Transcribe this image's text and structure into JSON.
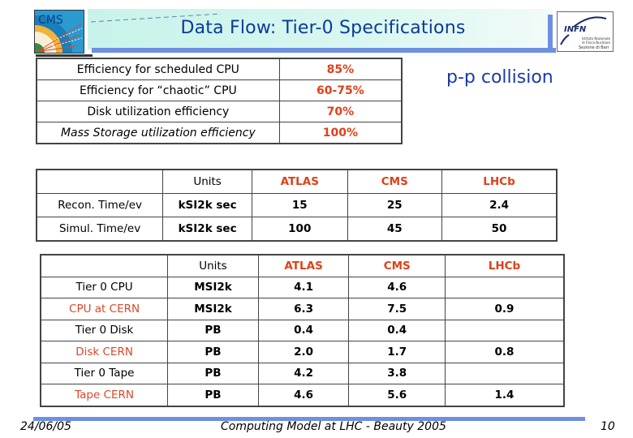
{
  "header": {
    "title": "Data Flow: Tier-0 Specifications",
    "left_logo": "CMS",
    "right_logo": "INFN",
    "right_logo_subtitle": "Istituto Nazionale di Fisica Nucleare Sezione di Bari"
  },
  "annotation": "p-p collision",
  "efficiency_table": {
    "rows": [
      {
        "label": "Efficiency for scheduled CPU",
        "value": "85%"
      },
      {
        "label": "Efficiency for “chaotic” CPU",
        "value": "60-75%"
      },
      {
        "label": "Disk utilization efficiency",
        "value": "70%"
      },
      {
        "label": "Mass Storage utilization efficiency",
        "value": "100%"
      }
    ]
  },
  "time_table": {
    "headers": [
      "",
      "Units",
      "ATLAS",
      "CMS",
      "LHCb"
    ],
    "rows": [
      [
        "Recon. Time/ev",
        "kSI2k sec",
        "15",
        "25",
        "2.4"
      ],
      [
        "Simul. Time/ev",
        "kSI2k sec",
        "100",
        "45",
        "50"
      ]
    ]
  },
  "resource_table": {
    "headers": [
      "",
      "Units",
      "ATLAS",
      "CMS",
      "LHCb"
    ],
    "rows": [
      [
        "Tier 0 CPU",
        "MSI2k",
        "4.1",
        "4.6",
        ""
      ],
      [
        "CPU at CERN",
        "MSI2k",
        "6.3",
        "7.5",
        "0.9"
      ],
      [
        "Tier 0 Disk",
        "PB",
        "0.4",
        "0.4",
        ""
      ],
      [
        "Disk CERN",
        "PB",
        "2.0",
        "1.7",
        "0.8"
      ],
      [
        "Tier 0 Tape",
        "PB",
        "4.2",
        "3.8",
        ""
      ],
      [
        "Tape CERN",
        "PB",
        "4.6",
        "5.6",
        "1.4"
      ]
    ]
  },
  "footer": {
    "date": "24/06/05",
    "center": "Computing Model at LHC - Beauty 2005",
    "page": "10"
  },
  "colors": {
    "title_text": "#0a3a9a",
    "accent_bar": "#6f8fe0",
    "highlight_red": "#e0401a",
    "annotation_blue": "#1a3aa8"
  }
}
